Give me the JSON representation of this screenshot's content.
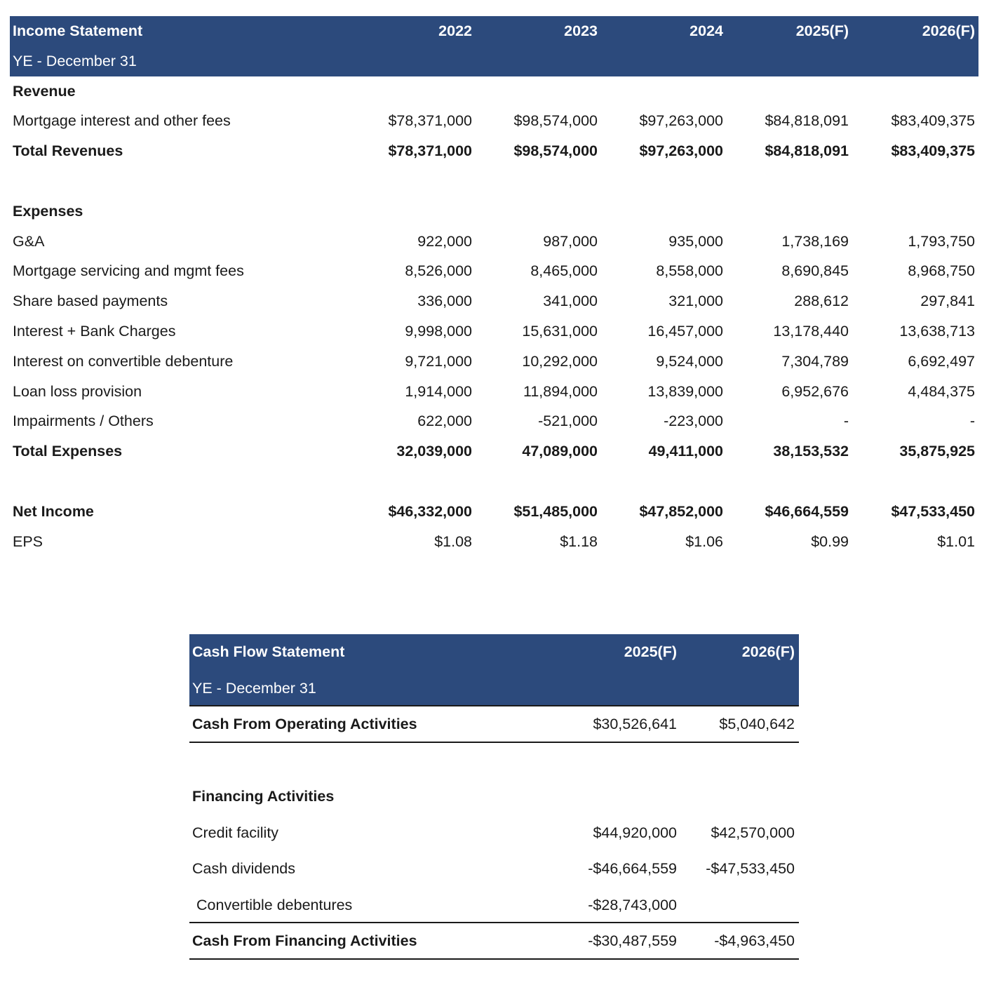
{
  "income_statement": {
    "title": "Income Statement",
    "subtitle": "YE - December 31",
    "columns": [
      "2022",
      "2023",
      "2024",
      "2025(F)",
      "2026(F)"
    ],
    "revenue_heading": "Revenue",
    "revenue_rows": [
      {
        "label": "Mortgage interest and other fees",
        "values": [
          "$78,371,000",
          "$98,574,000",
          "$97,263,000",
          "$84,818,091",
          "$83,409,375"
        ]
      }
    ],
    "total_revenues": {
      "label": "Total Revenues",
      "values": [
        "$78,371,000",
        "$98,574,000",
        "$97,263,000",
        "$84,818,091",
        "$83,409,375"
      ]
    },
    "expenses_heading": "Expenses",
    "expense_rows": [
      {
        "label": "G&A",
        "values": [
          "922,000",
          "987,000",
          "935,000",
          "1,738,169",
          "1,793,750"
        ]
      },
      {
        "label": "Mortgage servicing and mgmt fees",
        "values": [
          "8,526,000",
          "8,465,000",
          "8,558,000",
          "8,690,845",
          "8,968,750"
        ]
      },
      {
        "label": "Share based payments",
        "values": [
          "336,000",
          "341,000",
          "321,000",
          "288,612",
          "297,841"
        ]
      },
      {
        "label": "Interest + Bank Charges",
        "values": [
          "9,998,000",
          "15,631,000",
          "16,457,000",
          "13,178,440",
          "13,638,713"
        ]
      },
      {
        "label": "Interest on convertible debenture",
        "values": [
          "9,721,000",
          "10,292,000",
          "9,524,000",
          "7,304,789",
          "6,692,497"
        ]
      },
      {
        "label": "Loan loss provision",
        "values": [
          "1,914,000",
          "11,894,000",
          "13,839,000",
          "6,952,676",
          "4,484,375"
        ]
      },
      {
        "label": "Impairments / Others",
        "values": [
          "622,000",
          "-521,000",
          "-223,000",
          "-",
          "-"
        ]
      }
    ],
    "total_expenses": {
      "label": "Total Expenses",
      "values": [
        "32,039,000",
        "47,089,000",
        "49,411,000",
        "38,153,532",
        "35,875,925"
      ]
    },
    "net_income": {
      "label": "Net Income",
      "values": [
        "$46,332,000",
        "$51,485,000",
        "$47,852,000",
        "$46,664,559",
        "$47,533,450"
      ]
    },
    "eps": {
      "label": "EPS",
      "values": [
        "$1.08",
        "$1.18",
        "$1.06",
        "$0.99",
        "$1.01"
      ]
    }
  },
  "cash_flow_statement": {
    "title": "Cash Flow Statement",
    "subtitle": "YE - December 31",
    "columns": [
      "2025(F)",
      "2026(F)"
    ],
    "operating": {
      "label": "Cash From Operating Activities",
      "values": [
        "$30,526,641",
        "$5,040,642"
      ]
    },
    "financing_heading": "Financing Activities",
    "financing_rows": [
      {
        "label": "Credit facility",
        "values": [
          "$44,920,000",
          "$42,570,000"
        ]
      },
      {
        "label": "Cash dividends",
        "values": [
          "-$46,664,559",
          "-$47,533,450"
        ]
      },
      {
        "label": "Convertible debentures",
        "values": [
          "-$28,743,000",
          ""
        ]
      }
    ],
    "financing_total": {
      "label": "Cash From Financing Activities",
      "values": [
        "-$30,487,559",
        "-$4,963,450"
      ]
    }
  },
  "colors": {
    "header_background": "#2c4a7c",
    "header_text": "#ffffff"
  }
}
